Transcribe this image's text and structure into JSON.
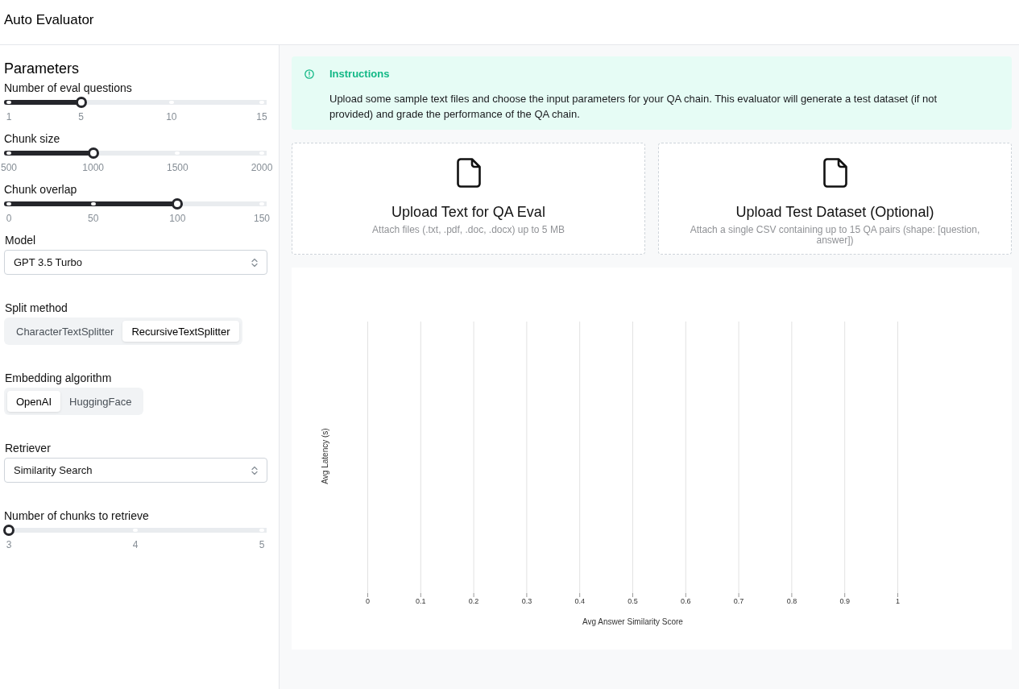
{
  "header": {
    "title": "Auto Evaluator"
  },
  "sidebar": {
    "title": "Parameters",
    "controls": [
      {
        "kind": "slider",
        "label": "Number of eval questions",
        "level": 0.2857,
        "marks": [
          "1",
          "5",
          "10",
          "15"
        ]
      },
      {
        "kind": "slider",
        "label": "Chunk size",
        "level": 0.3333,
        "marks": [
          "500",
          "1000",
          "1500",
          "2000"
        ]
      },
      {
        "kind": "slider",
        "label": "Chunk overlap",
        "level": 0.6667,
        "marks": [
          "0",
          "50",
          "100",
          "150"
        ]
      },
      {
        "kind": "select",
        "label": "Model",
        "value": "GPT 3.5 Turbo"
      },
      {
        "kind": "segmented",
        "label": "Split method",
        "options": [
          {
            "label": "CharacterTextSplitter",
            "selected": false
          },
          {
            "label": "RecursiveTextSplitter",
            "selected": true
          }
        ]
      },
      {
        "kind": "segmented",
        "label": "Embedding algorithm",
        "options": [
          {
            "label": "OpenAI",
            "selected": true
          },
          {
            "label": "HuggingFace",
            "selected": false
          }
        ]
      },
      {
        "kind": "select",
        "label": "Retriever",
        "value": "Similarity Search"
      },
      {
        "kind": "slider",
        "label": "Number of chunks to retrieve",
        "level": 0,
        "marks": [
          "3",
          "4",
          "5"
        ]
      }
    ]
  },
  "instructions": {
    "title": "Instructions",
    "text": "Upload some sample text files and choose the input parameters for your QA chain. This evaluator will generate a test dataset (if not provided) and grade the performance of the QA chain."
  },
  "uploads": [
    {
      "title": "Upload Text for QA Eval",
      "description": "Attach files (.txt, .pdf, .doc, .docx) up to 5 MB"
    },
    {
      "title": "Upload Test Dataset (Optional)",
      "description": "Attach a single CSV containing up to 15 QA pairs (shape: [question, answer])"
    }
  ],
  "chart": {
    "x_axis_title": "Avg Answer Similarity Score",
    "y_axis_title": "Avg Latency (s)",
    "x_tick_labels": [
      "0",
      "0.1",
      "0.2",
      "0.3",
      "0.4",
      "0.5",
      "0.6",
      "0.7",
      "0.8",
      "0.9",
      "1"
    ]
  }
}
